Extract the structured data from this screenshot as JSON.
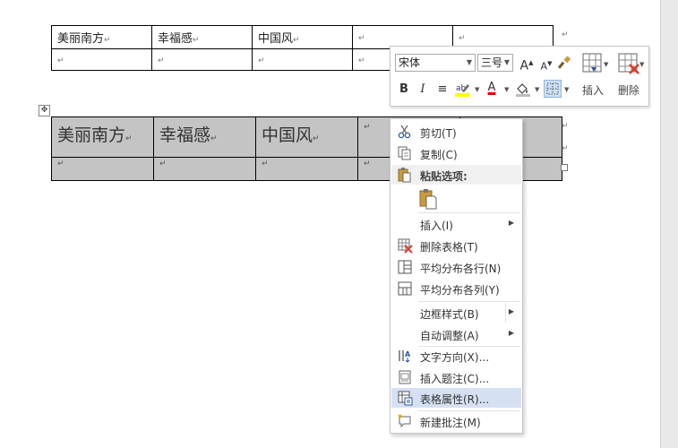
{
  "table1": {
    "row1": [
      "美丽南方",
      "幸福感",
      "中国风",
      "",
      ""
    ],
    "mark": "↵"
  },
  "table2": {
    "row1": [
      "美丽南方",
      "幸福感",
      "中国风",
      "",
      ""
    ],
    "mark": "↵",
    "move_handle": "✥"
  },
  "mini_toolbar": {
    "font_name": "宋体",
    "font_size": "三号",
    "grow_font": "A",
    "shrink_font": "A",
    "bold": "B",
    "italic": "I",
    "center": "≡",
    "font_color_letter": "A",
    "insert_label": "插入",
    "delete_label": "删除",
    "colors": {
      "highlight": "#ffff00",
      "font": "#e00000",
      "accent": "#2b579a"
    }
  },
  "context_menu": {
    "items": [
      {
        "label": "剪切(T)",
        "icon": "scissors-icon"
      },
      {
        "label": "复制(C)",
        "icon": "copy-icon"
      },
      {
        "label": "粘贴选项:",
        "icon": "paste-icon"
      },
      {
        "label": "插入(I)",
        "icon": ""
      },
      {
        "label": "删除表格(T)",
        "icon": "delete-table-icon"
      },
      {
        "label": "平均分布各行(N)",
        "icon": "distribute-rows-icon"
      },
      {
        "label": "平均分布各列(Y)",
        "icon": "distribute-columns-icon"
      },
      {
        "label": "边框样式(B)",
        "icon": ""
      },
      {
        "label": "自动调整(A)",
        "icon": ""
      },
      {
        "label": "文字方向(X)...",
        "icon": "text-direction-icon"
      },
      {
        "label": "插入题注(C)...",
        "icon": "insert-caption-icon"
      },
      {
        "label": "表格属性(R)...",
        "icon": "table-properties-icon"
      },
      {
        "label": "新建批注(M)",
        "icon": "new-comment-icon"
      }
    ],
    "submenu_arrow": "▶"
  }
}
